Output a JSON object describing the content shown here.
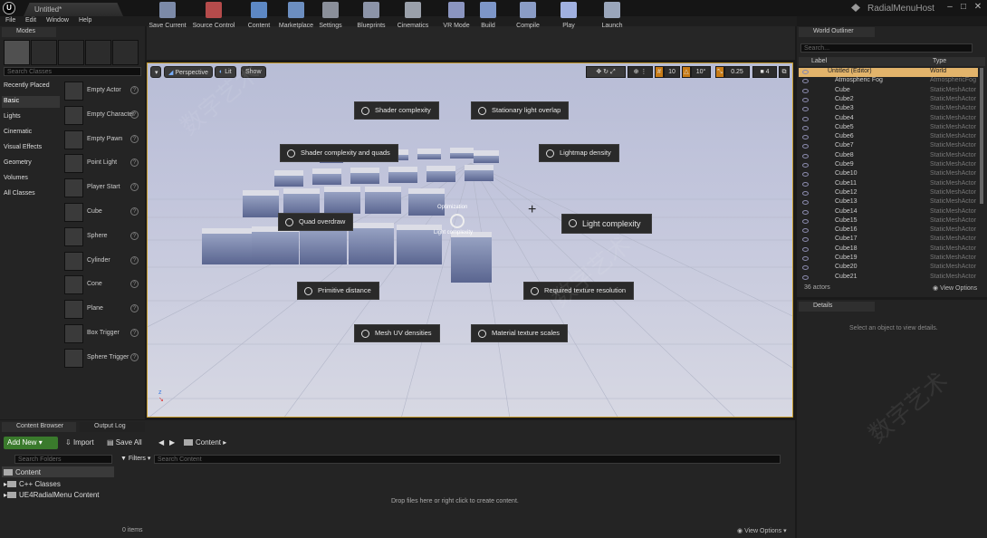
{
  "window": {
    "doc_tab": "Untitled*",
    "host_title": "RadialMenuHost",
    "controls": [
      "–",
      "□",
      "✕"
    ]
  },
  "menubar": [
    "File",
    "Edit",
    "Window",
    "Help"
  ],
  "modes": {
    "tab_label": "Modes",
    "search_placeholder": "Search Classes",
    "categories": [
      "Recently Placed",
      "Basic",
      "Lights",
      "Cinematic",
      "Visual Effects",
      "Geometry",
      "Volumes",
      "All Classes"
    ],
    "actors": [
      "Empty Actor",
      "Empty Character",
      "Empty Pawn",
      "Point Light",
      "Player Start",
      "Cube",
      "Sphere",
      "Cylinder",
      "Cone",
      "Plane",
      "Box Trigger",
      "Sphere Trigger"
    ],
    "help": "?"
  },
  "toolbar": [
    {
      "label": "Save Current",
      "color": "#7c8aa8"
    },
    {
      "label": "Source Control",
      "color": "#b54b4b"
    },
    {
      "label": "Content",
      "color": "#5d88c4"
    },
    {
      "label": "Marketplace",
      "color": "#6c8ec0"
    },
    {
      "label": "Settings",
      "color": "#8a8f99"
    },
    {
      "label": "Blueprints",
      "color": "#8c94a8"
    },
    {
      "label": "Cinematics",
      "color": "#9aa0aa"
    },
    {
      "label": "VR Mode",
      "color": "#8b95c0"
    },
    {
      "label": "Build",
      "color": "#7d96c8"
    },
    {
      "label": "Compile",
      "color": "#8a9cc5"
    },
    {
      "label": "Play",
      "color": "#a0b0e0"
    },
    {
      "label": "Launch",
      "color": "#9aa6bb"
    }
  ],
  "viewport": {
    "perspective": "Perspective",
    "lit": "Lit",
    "show": "Show",
    "grid": "10",
    "angle": "10°",
    "scale": "0.25",
    "camera": "4",
    "center_top": "Optimization",
    "center_bottom": "Light complexity",
    "radial_items": [
      "Shader complexity",
      "Stationary light overlap",
      "Shader complexity and quads",
      "Lightmap density",
      "Quad overdraw",
      "Light complexity",
      "Primitive distance",
      "Required texture resolution",
      "Mesh UV densities",
      "Material texture scales"
    ]
  },
  "outliner": {
    "tab_label": "World Outliner",
    "search_placeholder": "Search...",
    "col_label": "Label",
    "col_type": "Type",
    "rows": [
      {
        "name": "Untitled (Editor)",
        "type": "World"
      },
      {
        "name": "Atmospheric Fog",
        "type": "AtmosphericFog"
      },
      {
        "name": "Cube",
        "type": "StaticMeshActor"
      },
      {
        "name": "Cube2",
        "type": "StaticMeshActor"
      },
      {
        "name": "Cube3",
        "type": "StaticMeshActor"
      },
      {
        "name": "Cube4",
        "type": "StaticMeshActor"
      },
      {
        "name": "Cube5",
        "type": "StaticMeshActor"
      },
      {
        "name": "Cube6",
        "type": "StaticMeshActor"
      },
      {
        "name": "Cube7",
        "type": "StaticMeshActor"
      },
      {
        "name": "Cube8",
        "type": "StaticMeshActor"
      },
      {
        "name": "Cube9",
        "type": "StaticMeshActor"
      },
      {
        "name": "Cube10",
        "type": "StaticMeshActor"
      },
      {
        "name": "Cube11",
        "type": "StaticMeshActor"
      },
      {
        "name": "Cube12",
        "type": "StaticMeshActor"
      },
      {
        "name": "Cube13",
        "type": "StaticMeshActor"
      },
      {
        "name": "Cube14",
        "type": "StaticMeshActor"
      },
      {
        "name": "Cube15",
        "type": "StaticMeshActor"
      },
      {
        "name": "Cube16",
        "type": "StaticMeshActor"
      },
      {
        "name": "Cube17",
        "type": "StaticMeshActor"
      },
      {
        "name": "Cube18",
        "type": "StaticMeshActor"
      },
      {
        "name": "Cube19",
        "type": "StaticMeshActor"
      },
      {
        "name": "Cube20",
        "type": "StaticMeshActor"
      },
      {
        "name": "Cube21",
        "type": "StaticMeshActor"
      }
    ],
    "count": "36 actors",
    "view_options": "View Options"
  },
  "details": {
    "tab_label": "Details",
    "empty": "Select an object to view details."
  },
  "content_browser": {
    "tab_label": "Content Browser",
    "output_tab": "Output Log",
    "add_new": "Add New",
    "import": "Import",
    "save_all": "Save All",
    "path": "Content",
    "search_folders": "Search Folders",
    "filters": "Filters",
    "search_content": "Search Content",
    "tree": [
      "Content",
      "C++ Classes",
      "UE4RadialMenu Content"
    ],
    "drop_hint": "Drop files here or right click to create content.",
    "items": "0 items",
    "view_options": "View Options"
  },
  "watermark": "数字艺术"
}
